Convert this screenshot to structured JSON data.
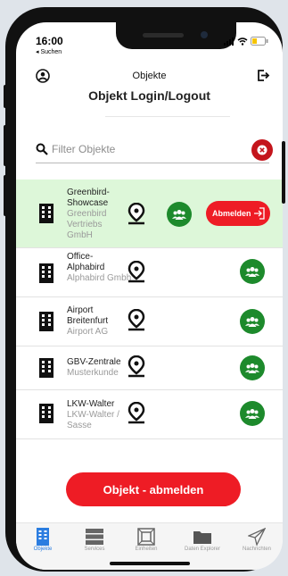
{
  "status_bar": {
    "time": "16:00",
    "back_label": "◂ Suchen"
  },
  "nav": {
    "title": "Objekte"
  },
  "page": {
    "title": "Objekt Login/Logout"
  },
  "search": {
    "placeholder": "Filter Objekte",
    "value": ""
  },
  "objects": [
    {
      "name": "Greenbird-Showcase",
      "sub": "Greenbird Vertriebs GmbH",
      "logout_label": "Abmelden"
    },
    {
      "name": "Office-Alphabird",
      "sub": "Alphabird Gmbh"
    },
    {
      "name": "Airport Breitenfurt",
      "sub": "Airport AG"
    },
    {
      "name": "GBV-Zentrale",
      "sub": "Musterkunde"
    },
    {
      "name": "LKW-Walter",
      "sub": "LKW-Walter / Sasse"
    }
  ],
  "main_button": {
    "label": "Objekt - abmelden"
  },
  "tabs": [
    {
      "label": "Objekte",
      "icon": "building-icon",
      "active": true
    },
    {
      "label": "Services",
      "icon": "server-icon"
    },
    {
      "label": "Einheiten",
      "icon": "unit-icon"
    },
    {
      "label": "Daten Explorer",
      "icon": "folder-icon"
    },
    {
      "label": "Nachrichten",
      "icon": "send-icon"
    }
  ],
  "colors": {
    "accent_red": "#ee1c25",
    "green": "#1d8a2c",
    "active_row": "#ddf7d9",
    "tab_active": "#2b7de0"
  }
}
